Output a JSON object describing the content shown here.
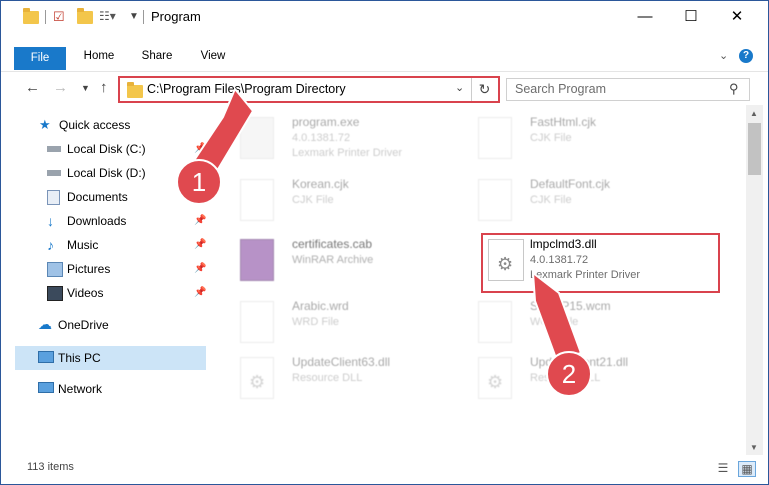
{
  "window": {
    "title": "Program",
    "minimize": "—",
    "maximize": "☐",
    "close": "✕"
  },
  "ribbon": {
    "tabs": [
      "File",
      "Home",
      "Share",
      "View"
    ],
    "help": "?"
  },
  "navbar": {
    "address": "C:\\Program Files\\Program Directory",
    "search_placeholder": "Search Program"
  },
  "navpane": {
    "quick_access": "Quick access",
    "items": [
      "Local Disk (C:)",
      "Local Disk (D:)",
      "Documents",
      "Downloads",
      "Music",
      "Pictures",
      "Videos"
    ],
    "onedrive": "OneDrive",
    "thispc": "This PC",
    "network": "Network"
  },
  "files": [
    {
      "name": "program.exe",
      "sub1": "4.0.1381.72",
      "sub2": "Lexmark Printer Driver"
    },
    {
      "name": "FastHtml.cjk",
      "sub1": "CJK File",
      "sub2": ""
    },
    {
      "name": "Korean.cjk",
      "sub1": "CJK File",
      "sub2": ""
    },
    {
      "name": "DefaultFont.cjk",
      "sub1": "CJK File",
      "sub2": ""
    },
    {
      "name": "certificates.cab",
      "sub1": "WinRAR Archive",
      "sub2": ""
    },
    {
      "name": "lmpclmd3.dll",
      "sub1": "4.0.1381.72",
      "sub2": "Lexmark Printer Driver"
    },
    {
      "name": "Arabic.wrd",
      "sub1": "WRD File",
      "sub2": ""
    },
    {
      "name": "SysWP15.wcm",
      "sub1": "WCM File",
      "sub2": ""
    },
    {
      "name": "UpdateClient63.dll",
      "sub1": "Resource DLL",
      "sub2": ""
    },
    {
      "name": "UpdateClient21.dll",
      "sub1": "Resource DLL",
      "sub2": ""
    }
  ],
  "callouts": [
    "1",
    "2"
  ],
  "status": {
    "count": "113 items"
  },
  "colors": {
    "accent": "#1979ca",
    "highlight": "#d9434d",
    "selected": "#cce4f7"
  }
}
